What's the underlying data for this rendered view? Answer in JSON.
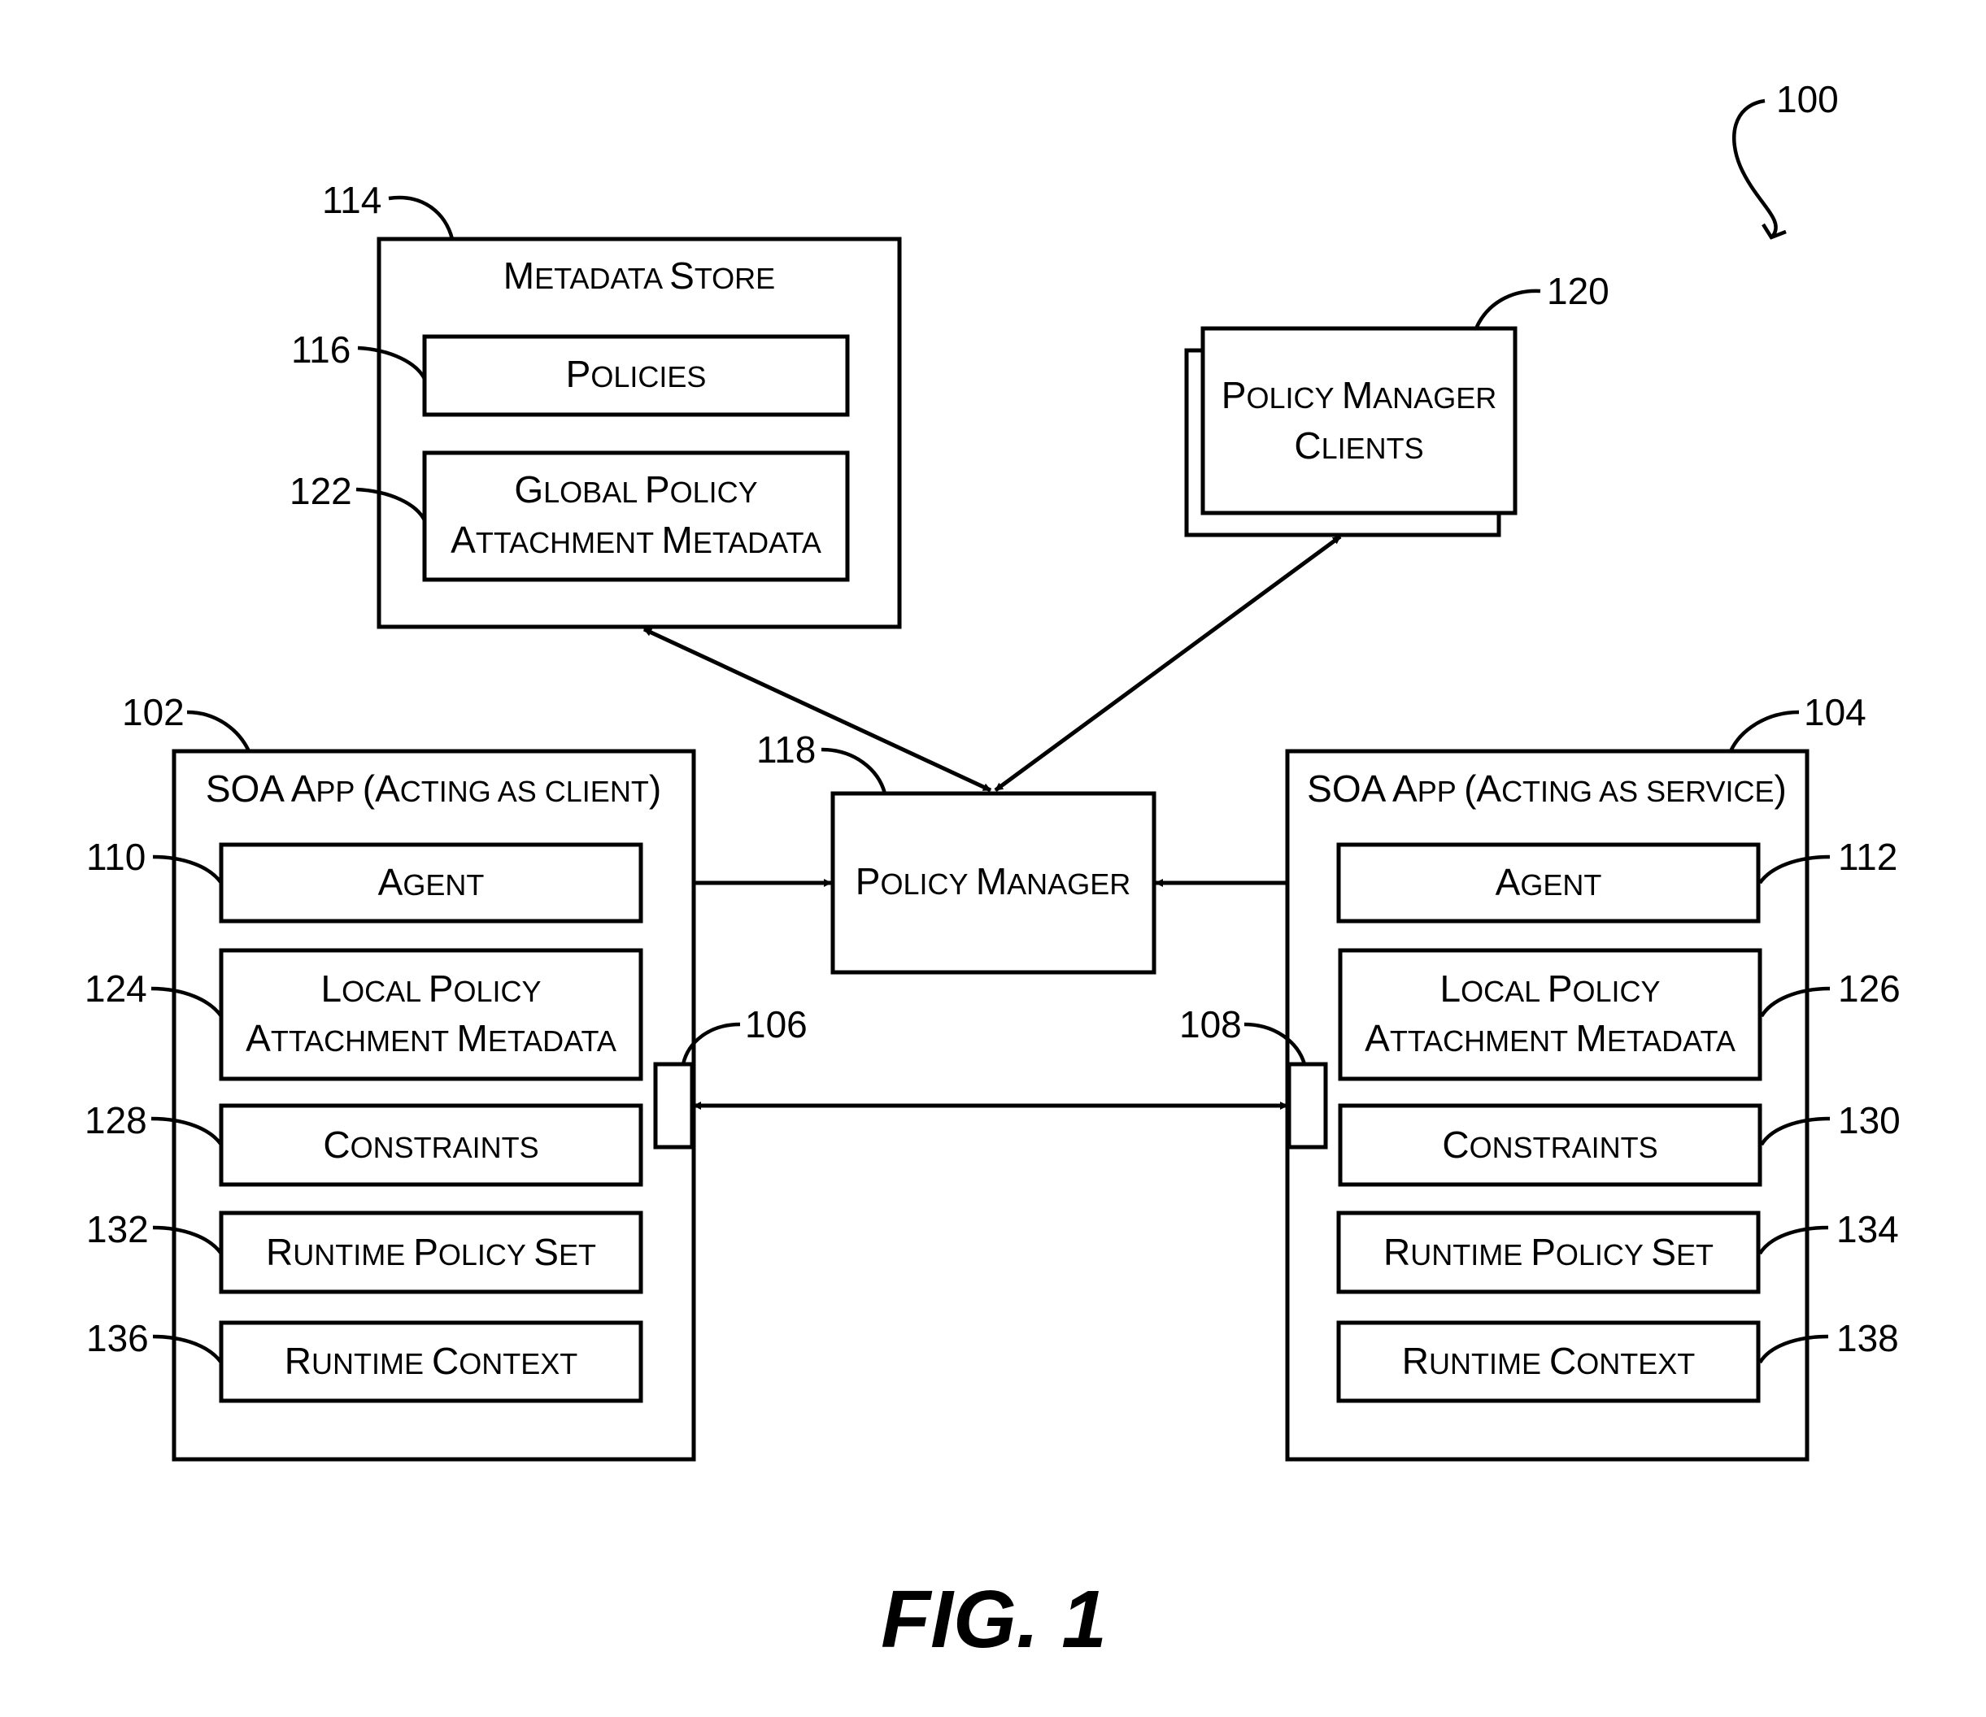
{
  "figure": {
    "caption": "FIG. 1",
    "ref": "100"
  },
  "metadata_store": {
    "ref": "114",
    "title": {
      "big1": "M",
      "small1": "ETADATA ",
      "big2": "S",
      "small2": "TORE"
    },
    "policies": {
      "ref": "116",
      "big1": "P",
      "small1": "OLICIES"
    },
    "global_policy": {
      "ref": "122",
      "line1": {
        "big1": "G",
        "small1": "LOBAL ",
        "big2": "P",
        "small2": "OLICY"
      },
      "line2": {
        "big1": "A",
        "small1": "TTACHMENT ",
        "big2": "M",
        "small2": "ETADATA"
      }
    }
  },
  "policy_manager_clients": {
    "ref": "120",
    "line1": {
      "big1": "P",
      "small1": "OLICY ",
      "big2": "M",
      "small2": "ANAGER"
    },
    "line2": {
      "big1": "C",
      "small1": "LIENTS"
    }
  },
  "policy_manager": {
    "ref": "118",
    "label": {
      "big1": "P",
      "small1": "OLICY ",
      "big2": "M",
      "small2": "ANAGER"
    }
  },
  "client_app": {
    "ref": "102",
    "title": {
      "big1": "SOA A",
      "small1": "PP ",
      "big2": "(A",
      "small2": "CTING AS CLIENT",
      "big3": ")"
    },
    "port_ref": "106",
    "agent": {
      "ref": "110",
      "big1": "A",
      "small1": "GENT"
    },
    "local_policy": {
      "ref": "124",
      "line1": {
        "big1": "L",
        "small1": "OCAL ",
        "big2": "P",
        "small2": "OLICY"
      },
      "line2": {
        "big1": "A",
        "small1": "TTACHMENT ",
        "big2": "M",
        "small2": "ETADATA"
      }
    },
    "constraints": {
      "ref": "128",
      "big1": "C",
      "small1": "ONSTRAINTS"
    },
    "runtime_policy_set": {
      "ref": "132",
      "big1": "R",
      "small1": "UNTIME ",
      "big2": "P",
      "small2": "OLICY ",
      "big3": "S",
      "small3": "ET"
    },
    "runtime_context": {
      "ref": "136",
      "big1": "R",
      "small1": "UNTIME ",
      "big2": "C",
      "small2": "ONTEXT"
    }
  },
  "service_app": {
    "ref": "104",
    "title": {
      "big1": "SOA A",
      "small1": "PP ",
      "big2": "(A",
      "small2": "CTING AS SERVICE",
      "big3": ")"
    },
    "port_ref": "108",
    "agent": {
      "ref": "112",
      "big1": "A",
      "small1": "GENT"
    },
    "local_policy": {
      "ref": "126",
      "line1": {
        "big1": "L",
        "small1": "OCAL ",
        "big2": "P",
        "small2": "OLICY"
      },
      "line2": {
        "big1": "A",
        "small1": "TTACHMENT ",
        "big2": "M",
        "small2": "ETADATA"
      }
    },
    "constraints": {
      "ref": "130",
      "big1": "C",
      "small1": "ONSTRAINTS"
    },
    "runtime_policy_set": {
      "ref": "134",
      "big1": "R",
      "small1": "UNTIME ",
      "big2": "P",
      "small2": "OLICY ",
      "big3": "S",
      "small3": "ET"
    },
    "runtime_context": {
      "ref": "138",
      "big1": "R",
      "small1": "UNTIME ",
      "big2": "C",
      "small2": "ONTEXT"
    }
  }
}
